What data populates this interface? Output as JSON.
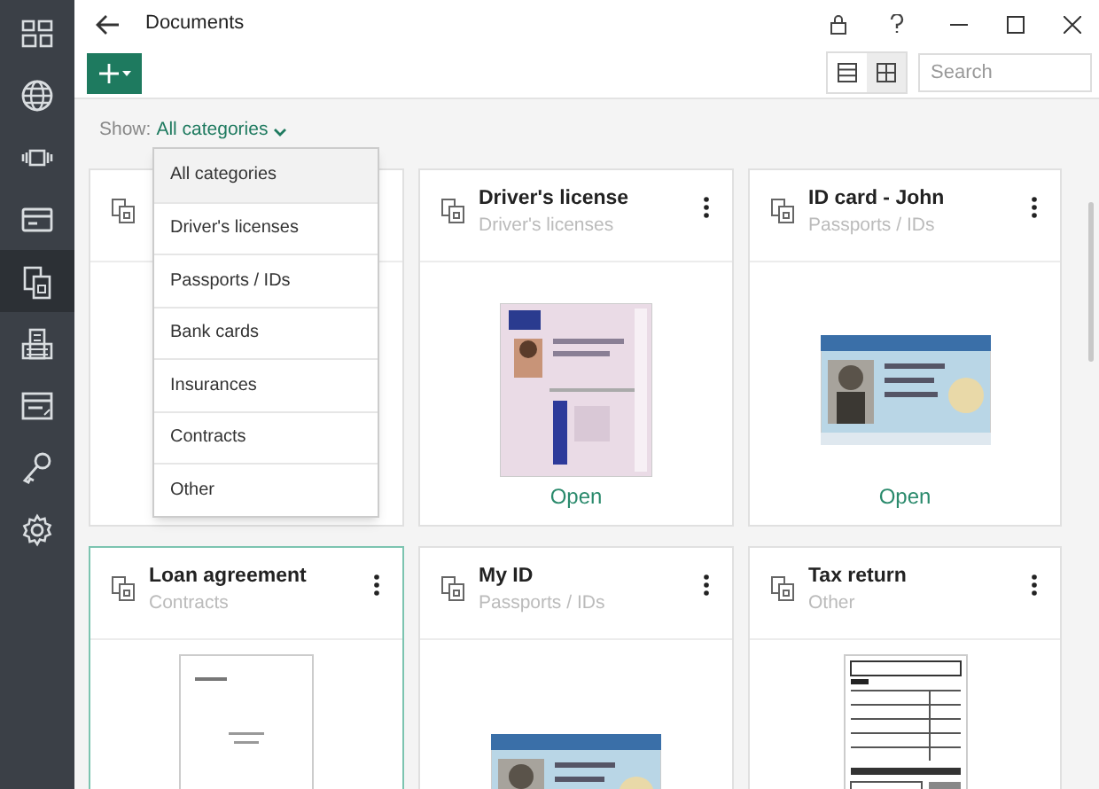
{
  "window": {
    "title": "Documents"
  },
  "sidebar": {
    "items": [
      {
        "selected": false
      },
      {
        "selected": false
      },
      {
        "selected": false
      },
      {
        "selected": false
      },
      {
        "selected": true
      },
      {
        "selected": false
      },
      {
        "selected": false
      },
      {
        "selected": false
      },
      {
        "selected": false
      }
    ]
  },
  "toolbar": {
    "views": [
      {
        "selected": false
      },
      {
        "selected": true
      }
    ],
    "search": {
      "placeholder": "Search"
    }
  },
  "filter": {
    "label": "Show:",
    "value": "All categories"
  },
  "dropdown": {
    "items": [
      {
        "label": "All categories",
        "selected": true
      },
      {
        "label": "Driver's licenses",
        "selected": false
      },
      {
        "label": "Passports / IDs",
        "selected": false
      },
      {
        "label": "Bank cards",
        "selected": false
      },
      {
        "label": "Insurances",
        "selected": false
      },
      {
        "label": "Contracts",
        "selected": false
      },
      {
        "label": "Other",
        "selected": false
      }
    ]
  },
  "cards": [
    {
      "selected": false
    },
    {
      "title": "Driver's license",
      "category": "Driver's licenses",
      "selected": false,
      "action": "Open"
    },
    {
      "title": "ID card - John",
      "category": "Passports / IDs",
      "selected": false,
      "action": "Open"
    },
    {
      "title": "Loan agreement",
      "category": "Contracts",
      "selected": true
    },
    {
      "title": "My ID",
      "category": "Passports / IDs",
      "selected": false
    },
    {
      "title": "Tax return",
      "category": "Other",
      "selected": false
    }
  ]
}
